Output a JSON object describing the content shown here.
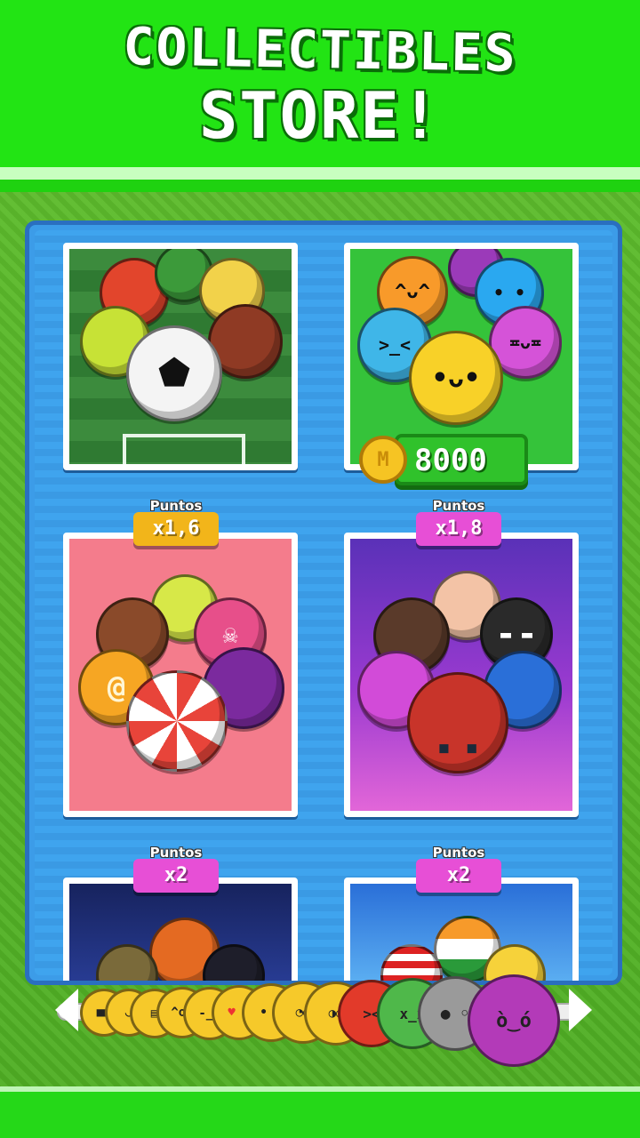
{
  "banner": {
    "line1": "COLLECTIBLES",
    "line2": "STORE!"
  },
  "price": {
    "amount": "8000",
    "coin_icon": "coin-icon"
  },
  "badges": [
    {
      "label": "Puntos",
      "value": "x1,6",
      "color": "#f2b51a"
    },
    {
      "label": "Puntos",
      "value": "x1,8",
      "color": "#e74fd6"
    },
    {
      "label": "Puntos",
      "value": "x2",
      "color": "#e74fd6"
    },
    {
      "label": "Puntos",
      "value": "x2",
      "color": "#e74fd6"
    }
  ],
  "colors": {
    "banner": "#22e414",
    "frame": "#3c9ce8",
    "price_button": "#30c22b"
  }
}
